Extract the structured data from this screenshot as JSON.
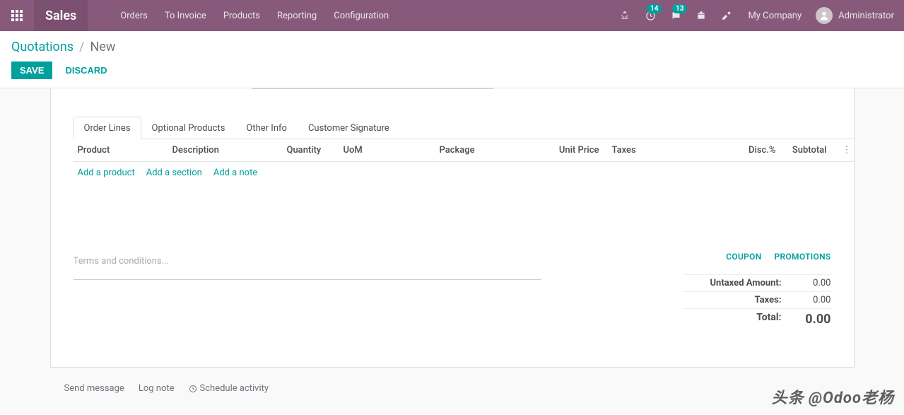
{
  "topnav": {
    "brand": "Sales",
    "menu": [
      "Orders",
      "To Invoice",
      "Products",
      "Reporting",
      "Configuration"
    ],
    "badge_conversations": "14",
    "badge_messages": "13",
    "company": "My Company",
    "user": "Administrator"
  },
  "breadcrumb": {
    "root": "Quotations",
    "sep": "/",
    "current": "New"
  },
  "buttons": {
    "save": "SAVE",
    "discard": "DISCARD"
  },
  "tabs": [
    "Order Lines",
    "Optional Products",
    "Other Info",
    "Customer Signature"
  ],
  "active_tab": 0,
  "columns": {
    "product": "Product",
    "description": "Description",
    "quantity": "Quantity",
    "uom": "UoM",
    "package": "Package",
    "unit_price": "Unit Price",
    "taxes": "Taxes",
    "disc": "Disc.%",
    "subtotal": "Subtotal"
  },
  "add_links": {
    "product": "Add a product",
    "section": "Add a section",
    "note": "Add a note"
  },
  "terms_placeholder": "Terms and conditions...",
  "promo": {
    "coupon": "COUPON",
    "promotions": "PROMOTIONS"
  },
  "totals": {
    "untaxed_label": "Untaxed Amount:",
    "untaxed_value": "0.00",
    "taxes_label": "Taxes:",
    "taxes_value": "0.00",
    "total_label": "Total:",
    "total_value": "0.00"
  },
  "chatter": {
    "send": "Send message",
    "log": "Log note",
    "schedule": "Schedule activity"
  },
  "watermark": "头条 @Odoo老杨"
}
